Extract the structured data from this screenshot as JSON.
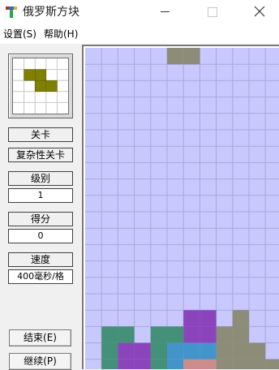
{
  "window": {
    "title": "俄罗斯方块",
    "icons": [
      "tetris-t-icon",
      "minimize-icon",
      "maximize-icon",
      "close-icon"
    ]
  },
  "menu": {
    "settings": "设置(S)",
    "help": "帮助(H)"
  },
  "panel": {
    "level_button": "关卡",
    "complex_level_button": "复杂性关卡",
    "grade_label": "级别",
    "grade_value": "1",
    "score_label": "得分",
    "score_value": "0",
    "speed_label": "速度",
    "speed_value": "400毫秒/格",
    "end_button": "结束(E)",
    "continue_button": "继续(P)"
  },
  "next_piece": {
    "shape": "Z",
    "color": "#808000",
    "cells": [
      [
        0,
        0
      ],
      [
        1,
        0
      ],
      [
        1,
        1
      ],
      [
        2,
        1
      ]
    ]
  },
  "board": {
    "background": "#c8c8ff",
    "grid_color": "#a8a8d8",
    "columns": 12,
    "falling_piece": {
      "color": "#8c8c78",
      "cells": [
        [
          5,
          0
        ],
        [
          6,
          0
        ]
      ]
    },
    "stack": [
      {
        "color": "#8c8c78",
        "cells": [
          [
            9,
            16
          ],
          [
            8,
            17
          ],
          [
            9,
            17
          ],
          [
            8,
            18
          ],
          [
            9,
            18
          ],
          [
            10,
            18
          ],
          [
            8,
            19
          ],
          [
            9,
            19
          ],
          [
            10,
            19
          ]
        ]
      },
      {
        "color": "#8c44bc",
        "cells": [
          [
            6,
            16
          ],
          [
            7,
            16
          ],
          [
            6,
            17
          ],
          [
            7,
            17
          ]
        ]
      },
      {
        "color": "#8c44bc",
        "cells": [
          [
            2,
            18
          ],
          [
            3,
            18
          ],
          [
            2,
            19
          ],
          [
            3,
            19
          ]
        ]
      },
      {
        "color": "#449078",
        "cells": [
          [
            1,
            17
          ],
          [
            2,
            17
          ],
          [
            1,
            18
          ],
          [
            1,
            19
          ]
        ]
      },
      {
        "color": "#449078",
        "cells": [
          [
            4,
            17
          ],
          [
            5,
            17
          ],
          [
            4,
            18
          ],
          [
            4,
            19
          ]
        ]
      },
      {
        "color": "#4494cc",
        "cells": [
          [
            5,
            18
          ],
          [
            6,
            18
          ],
          [
            5,
            19
          ]
        ]
      },
      {
        "color": "#4494cc",
        "cells": [
          [
            7,
            18
          ]
        ]
      },
      {
        "color": "#cc8c8c",
        "cells": [
          [
            6,
            19
          ],
          [
            7,
            19
          ]
        ]
      },
      {
        "color": "#8c8c78",
        "cells": [
          [
            11,
            19
          ]
        ]
      }
    ]
  }
}
